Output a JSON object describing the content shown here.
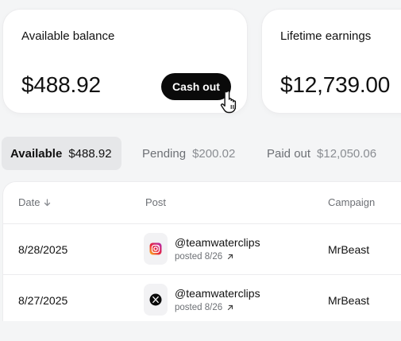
{
  "balance_card": {
    "label": "Available balance",
    "amount": "$488.92",
    "cashout_label": "Cash out"
  },
  "lifetime_card": {
    "label": "Lifetime earnings",
    "amount": "$12,739.00"
  },
  "tabs": [
    {
      "name": "Available",
      "value": "$488.92",
      "active": true
    },
    {
      "name": "Pending",
      "value": "$200.02",
      "active": false
    },
    {
      "name": "Paid out",
      "value": "$12,050.06",
      "active": false
    }
  ],
  "table": {
    "headers": {
      "date": "Date",
      "post": "Post",
      "campaign": "Campaign"
    },
    "sort_icon": "arrow-down-icon",
    "rows": [
      {
        "date": "8/28/2025",
        "platform": "instagram-icon",
        "handle": "@teamwaterclips",
        "posted": "posted 8/26",
        "campaign": "MrBeast"
      },
      {
        "date": "8/27/2025",
        "platform": "x-icon",
        "handle": "@teamwaterclips",
        "posted": "posted 8/26",
        "campaign": "MrBeast"
      }
    ]
  },
  "colors": {
    "button_bg": "#0a0a0a",
    "active_tab_bg": "#e6e7e9",
    "page_bg": "#f4f5f6"
  }
}
